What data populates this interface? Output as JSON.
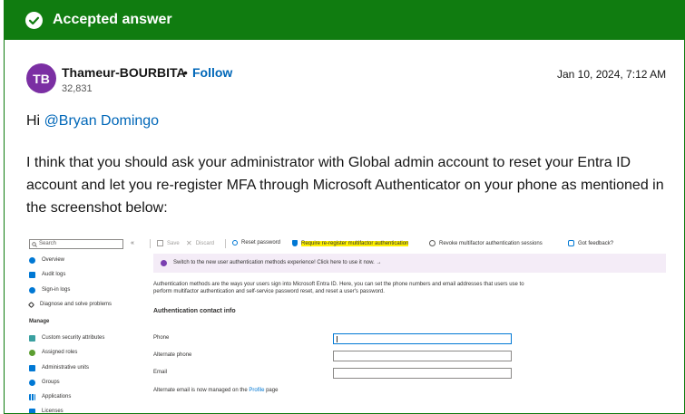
{
  "banner": {
    "label": "Accepted answer"
  },
  "post": {
    "avatar_initials": "TB",
    "author": "Thameur-BOURBITA",
    "separator": "•",
    "follow_label": "Follow",
    "reputation": "32,831",
    "date": "Jan 10, 2024, 7:12 AM",
    "greeting": "Hi ",
    "mention": "@Bryan Domingo",
    "body": "I think that you should ask your administrator with Global admin account to reset your Entra ID account and let you re-register MFA through Microsoft Authenticator on your phone as mentioned in the screenshot below:"
  },
  "screenshot": {
    "search_placeholder": "Search",
    "collapse_glyph": "«",
    "nav": [
      {
        "label": "Overview",
        "color": "#0078d4"
      },
      {
        "label": "Audit logs",
        "color": "#0078d4"
      },
      {
        "label": "Sign-in logs",
        "color": "#0078d4"
      },
      {
        "label": "Diagnose and solve problems",
        "color": "#323130"
      }
    ],
    "manage_heading": "Manage",
    "manage_items": [
      {
        "label": "Custom security attributes",
        "color": "#3aa0a0"
      },
      {
        "label": "Assigned roles",
        "color": "#5c9e31"
      },
      {
        "label": "Administrative units",
        "color": "#0078d4"
      },
      {
        "label": "Groups",
        "color": "#0078d4"
      },
      {
        "label": "Applications",
        "color": "#0078d4"
      },
      {
        "label": "Licenses",
        "color": "#0078d4"
      }
    ],
    "toolbar": {
      "save": "Save",
      "discard": "Discard",
      "reset_password": "Reset password",
      "require_reregister": "Require re-register multifactor authentication",
      "revoke_sessions": "Revoke multifactor authentication sessions",
      "feedback": "Got feedback?"
    },
    "notice": "Switch to the new user authentication methods experience! Click here to use it now.  →",
    "description": "Authentication methods are the ways your users sign into Microsoft Entra ID. Here, you can set the phone numbers and email addresses that users use to perform multifactor authentication and self-service password reset, and reset a user's password.",
    "section_title": "Authentication contact info",
    "fields": [
      {
        "label": "Phone",
        "value": ""
      },
      {
        "label": "Alternate phone",
        "value": ""
      },
      {
        "label": "Email",
        "value": ""
      }
    ],
    "alt_email_text": "Alternate email is now managed on the ",
    "alt_email_link": "Profile",
    "alt_email_suffix": " page"
  },
  "colors": {
    "accent_green": "#107c10",
    "link_blue": "#0067b8",
    "avatar_purple": "#7b2fa3",
    "highlight": "#fff100"
  }
}
